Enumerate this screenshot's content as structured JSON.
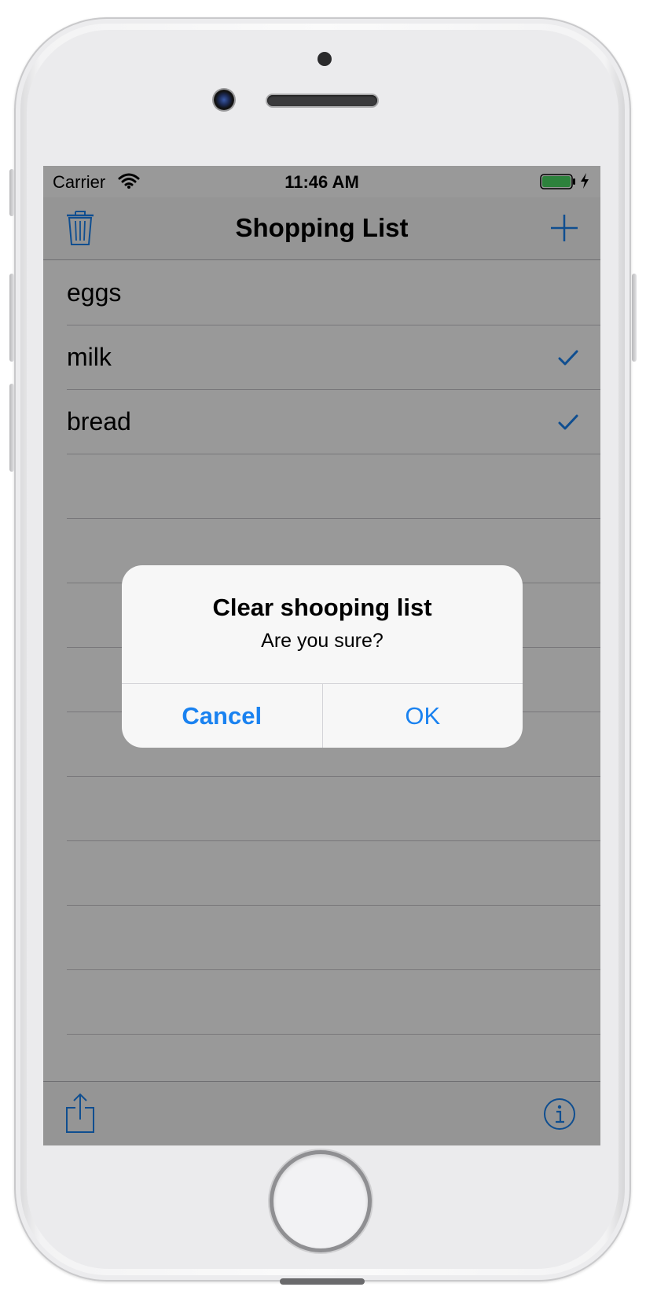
{
  "status_bar": {
    "carrier": "Carrier",
    "time": "11:46 AM",
    "wifi_icon": "wifi-icon",
    "battery_icon": "battery-charging-icon",
    "battery_color": "#4cd964"
  },
  "nav_bar": {
    "title": "Shopping List",
    "left_icon": "trash-icon",
    "right_icon": "plus-icon"
  },
  "list": {
    "items": [
      {
        "label": "eggs",
        "checked": false
      },
      {
        "label": "milk",
        "checked": true
      },
      {
        "label": "bread",
        "checked": true
      }
    ]
  },
  "toolbar": {
    "left_icon": "share-icon",
    "right_icon": "info-icon"
  },
  "alert": {
    "title": "Clear shooping list",
    "message": "Are you sure?",
    "cancel_label": "Cancel",
    "ok_label": "OK",
    "button_color": "#1a82f0"
  }
}
